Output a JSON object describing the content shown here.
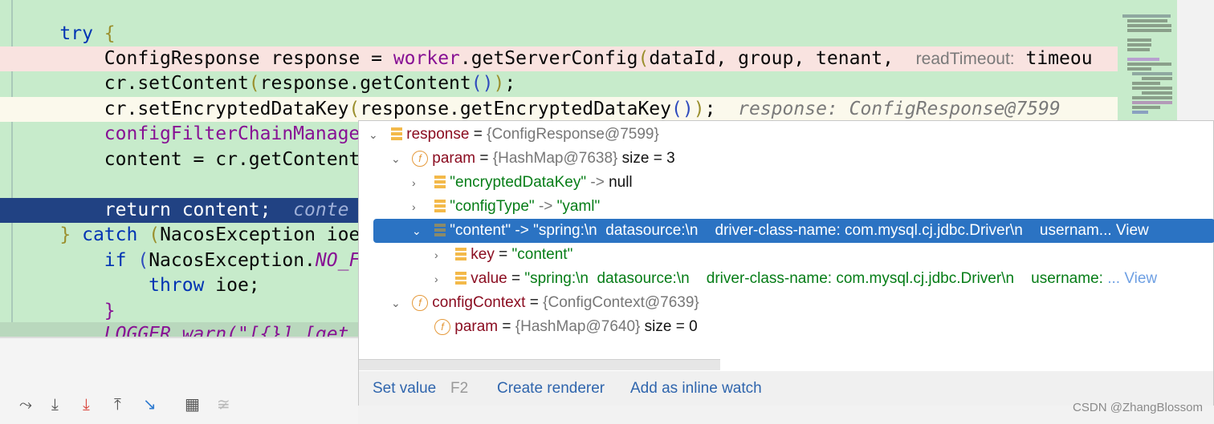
{
  "editor": {
    "lines": {
      "l1": {
        "kw": "try",
        "brace": " {"
      },
      "l2": {
        "a": "ConfigResponse response = ",
        "b": "worker",
        "c": ".getServerConfig",
        "d": "(",
        "e": "dataId, group, tenant,",
        "hint_label": "readTimeout:",
        "hint_val": " timeou"
      },
      "l3": {
        "a": "cr.setContent",
        "b": "(",
        "c": "response.getContent",
        "d": "()",
        "e": ")",
        "f": ";"
      },
      "l4": {
        "a": "cr.setEncryptedDataKey",
        "b": "(",
        "c": "response.getEncryptedDataKey",
        "d": "()",
        "e": ")",
        "f": ";",
        "hint": "response: ConfigResponse@7599"
      },
      "l5": {
        "a": "configFilterChainManage"
      },
      "l6": {
        "a": "content = cr.getContent"
      },
      "l8": {
        "a": "return content;",
        "hint": "conte"
      },
      "l9": {
        "a": "}",
        "b": "catch",
        "c": " (",
        "d": "NacosException ioe"
      },
      "l10": {
        "a": "if",
        "b": " (",
        "c": "NacosException.",
        "d": "NO_F"
      },
      "l11": {
        "a": "throw",
        "b": " ioe;"
      },
      "l12": {
        "a": "}"
      },
      "l13": {
        "a": "LOGGER.warn(\"[{}] [get"
      }
    }
  },
  "popup": {
    "rows": [
      {
        "name": "response",
        "eq": " = ",
        "type": "{ConfigResponse@7599}",
        "icon": "field-list-icon",
        "expanded": true
      },
      {
        "name": "param",
        "eq": " = ",
        "type": "{HashMap@7638}",
        "extra": " size = 3",
        "icon": "field-icon",
        "expanded": true
      },
      {
        "key": "\"encryptedDataKey\"",
        "arrow": " -> ",
        "val": "null",
        "icon": "entry-icon",
        "expanded": false
      },
      {
        "key": "\"configType\"",
        "arrow": " -> ",
        "val": "\"yaml\"",
        "icon": "entry-icon",
        "expanded": false
      },
      {
        "key": "\"content\"",
        "arrow": " -> ",
        "val": "\"spring:\\n  datasource:\\n    driver-class-name: com.mysql.cj.jdbc.Driver\\n    usernam...",
        "view": " View",
        "icon": "entry-icon",
        "expanded": true,
        "selected": true
      },
      {
        "name": "key",
        "eq": " = ",
        "val": "\"content\"",
        "icon": "entry-icon",
        "expanded": false
      },
      {
        "name": "value",
        "eq": " = ",
        "val": "\"spring:\\n  datasource:\\n    driver-class-name: com.mysql.cj.jdbc.Driver\\n    username: ",
        "view": "... View",
        "icon": "entry-icon",
        "expanded": false
      },
      {
        "name": "configContext",
        "eq": " = ",
        "type": "{ConfigContext@7639}",
        "icon": "field-icon",
        "expanded": true
      },
      {
        "name": "param",
        "eq": " = ",
        "type": "{HashMap@7640}",
        "extra": " size = 0",
        "icon": "field-icon"
      }
    ],
    "actions": {
      "set_value": "Set value",
      "set_value_key": "F2",
      "create_renderer": "Create renderer",
      "add_inline_watch": "Add as inline watch"
    }
  },
  "watermark": "CSDN @ZhangBlossom",
  "colors": {
    "editor_bg": "#c7ebcb",
    "selection": "#2b73c3",
    "exec_line": "#214283"
  }
}
